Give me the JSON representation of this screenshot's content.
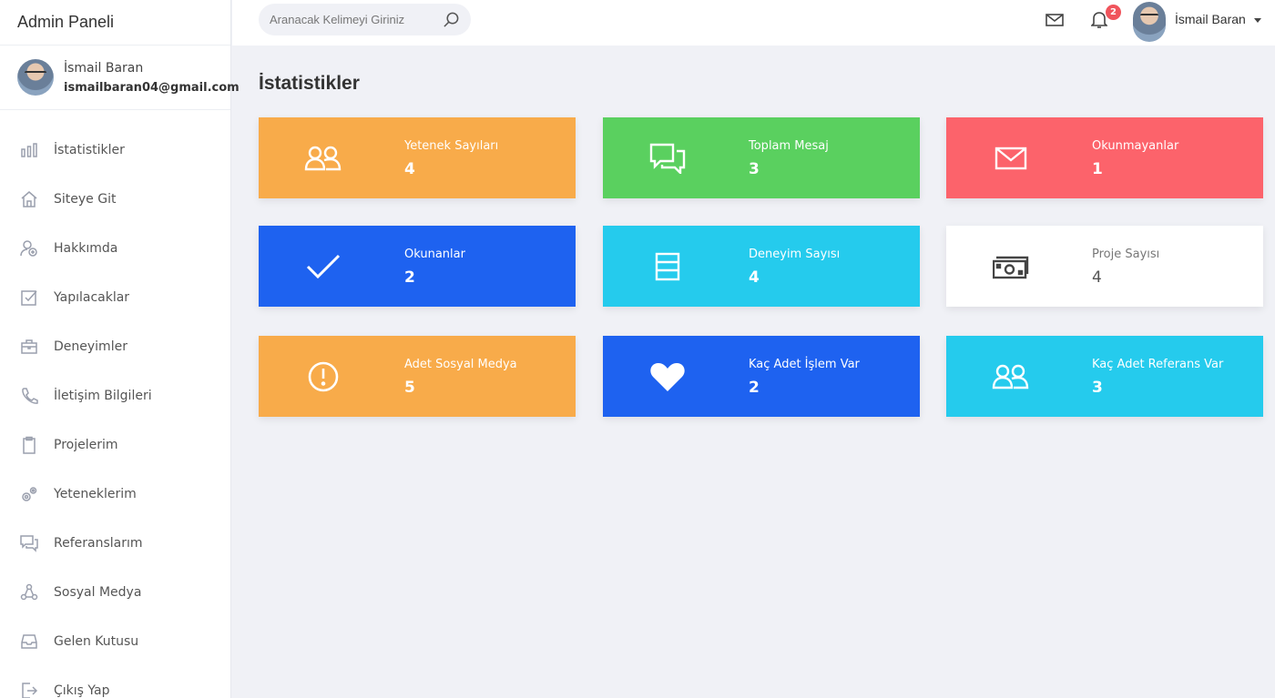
{
  "brand": "Admin Paneli",
  "profile": {
    "name": "İsmail Baran",
    "email": "ismailbaran04@gmail.com"
  },
  "menu": [
    {
      "label": "İstatistikler",
      "icon": "bar-chart-icon"
    },
    {
      "label": "Siteye Git",
      "icon": "home-icon"
    },
    {
      "label": "Hakkımda",
      "icon": "user-plus-icon"
    },
    {
      "label": "Yapılacaklar",
      "icon": "check-square-icon"
    },
    {
      "label": "Deneyimler",
      "icon": "briefcase-icon"
    },
    {
      "label": "İletişim Bilgileri",
      "icon": "phone-icon"
    },
    {
      "label": "Projelerim",
      "icon": "clipboard-icon"
    },
    {
      "label": "Yeteneklerim",
      "icon": "gears-icon"
    },
    {
      "label": "Referanslarım",
      "icon": "chat-icon"
    },
    {
      "label": "Sosyal Medya",
      "icon": "share-icon"
    },
    {
      "label": "Gelen Kutusu",
      "icon": "inbox-icon"
    },
    {
      "label": "Çıkış Yap",
      "icon": "logout-icon"
    }
  ],
  "topbar": {
    "search_placeholder": "Aranacak Kelimeyi Giriniz",
    "notification_count": "2",
    "user_name": "İsmail Baran"
  },
  "page_title": "İstatistikler",
  "cards": [
    {
      "label": "Yetenek Sayıları",
      "value": "4",
      "color": "#f8ab4a",
      "icon": "users-icon"
    },
    {
      "label": "Toplam Mesaj",
      "value": "3",
      "color": "#5ad05f",
      "icon": "chat-bubbles-icon"
    },
    {
      "label": "Okunmayanlar",
      "value": "1",
      "color": "#fc636b",
      "icon": "mail-icon"
    },
    {
      "label": "Okunanlar",
      "value": "2",
      "color": "#1e62f0",
      "icon": "check-icon"
    },
    {
      "label": "Deneyim Sayısı",
      "value": "4",
      "color": "#25cbed",
      "icon": "list-box-icon"
    },
    {
      "label": "Proje Sayısı",
      "value": "4",
      "color": "#ffffff",
      "icon": "money-icon"
    },
    {
      "label": "Adet Sosyal Medya",
      "value": "5",
      "color": "#f8ab4a",
      "icon": "alert-circle-icon"
    },
    {
      "label": "Kaç Adet İşlem Var",
      "value": "2",
      "color": "#1e62f0",
      "icon": "heart-icon"
    },
    {
      "label": "Kaç Adet Referans Var",
      "value": "3",
      "color": "#25cbed",
      "icon": "users-icon"
    }
  ]
}
